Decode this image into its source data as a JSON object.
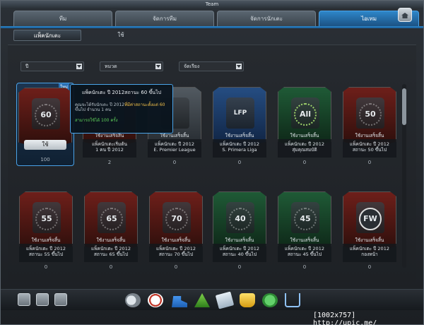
{
  "window": {
    "title": "Team"
  },
  "tabs": [
    {
      "label": "ทีม"
    },
    {
      "label": "จัดการทีม"
    },
    {
      "label": "จัดการนักเตะ"
    },
    {
      "label": "ไอเทม"
    }
  ],
  "subtabs": [
    {
      "label": "แพ็คนักเตะ"
    },
    {
      "label": "ใช้"
    }
  ],
  "filters": {
    "year": "ปี",
    "category": "หมวด",
    "sort": "จัดเรียง"
  },
  "featured": {
    "badge": "60",
    "button": "ใช้",
    "count": "100",
    "tag": "ใหม่"
  },
  "tooltip": {
    "title": "แพ็คนักเตะ ปี 2012สถานะ 60 ขึ้นไป",
    "body_prefix": "คุณจะได้รับนักเตะ ปี 2012",
    "body_highlight": "ที่มีค่าสถานะตั้งแต่ 60",
    "body_suffix": "ขึ้นไป จำนวน 1 คน",
    "usage": "สามารถใช้ได้ 100 ครั้ง"
  },
  "row1": [
    {
      "badge": "",
      "label": "ใช้งานเสร็จสิ้น",
      "desc1": "แพ็คนักเตะเริ่มต้น",
      "desc2": "1 คน ปี 2012",
      "count": "2"
    },
    {
      "badge": "",
      "label": "ใช้งานเสร็จสิ้น",
      "desc1": "แพ็คนักเตะ ปี 2012",
      "desc2": "E. Premier League",
      "count": "0"
    },
    {
      "badge": "LFP",
      "label": "ใช้งานเสร็จสิ้น",
      "desc1": "แพ็คนักเตะ ปี 2012",
      "desc2": "S. Primera Liga",
      "count": "0"
    },
    {
      "badge": "All",
      "label": "ใช้งานเสร็จสิ้น",
      "desc1": "แพ็คนักเตะ ปี 2012",
      "desc2": "สุ่มคุณสมบัติ",
      "count": "0"
    },
    {
      "badge": "50",
      "label": "ใช้งานเสร็จสิ้น",
      "desc1": "แพ็คนักเตะ ปี 2012",
      "desc2": "สถานะ 50 ขึ้นไป",
      "count": "0"
    }
  ],
  "row2": [
    {
      "badge": "55",
      "label": "ใช้งานเสร็จสิ้น",
      "desc1": "แพ็คนักเตะ ปี 2012",
      "desc2": "สถานะ 55 ขึ้นไป",
      "count": "0"
    },
    {
      "badge": "65",
      "label": "ใช้งานเสร็จสิ้น",
      "desc1": "แพ็คนักเตะ ปี 2012",
      "desc2": "สถานะ 65 ขึ้นไป",
      "count": "0"
    },
    {
      "badge": "70",
      "label": "ใช้งานเสร็จสิ้น",
      "desc1": "แพ็คนักเตะ ปี 2012",
      "desc2": "สถานะ 70 ขึ้นไป",
      "count": "0"
    },
    {
      "badge": "40",
      "label": "ใช้งานเสร็จสิ้น",
      "desc1": "แพ็คนักเตะ ปี 2012",
      "desc2": "สถานะ 40 ขึ้นไป",
      "count": "0"
    },
    {
      "badge": "45",
      "label": "ใช้งานเสร็จสิ้น",
      "desc1": "แพ็คนักเตะ ปี 2012",
      "desc2": "สถานะ 45 ขึ้นไป",
      "count": "0"
    },
    {
      "badge": "FW",
      "label": "ใช้งานเสร็จสิ้น",
      "desc1": "แพ็คนักเตะ ปี 2012",
      "desc2": "กองหน้า",
      "count": "0"
    }
  ],
  "watermark": "[1002x757] http://upic.me/",
  "icons": {
    "bottom_left": [
      "profile-icon",
      "chat-icon",
      "mail-icon"
    ],
    "tools": [
      "whistle-icon",
      "ball-icon",
      "boot-icon",
      "cone-icon",
      "cards-icon",
      "trophy-icon",
      "club-icon",
      "cart-icon"
    ]
  }
}
